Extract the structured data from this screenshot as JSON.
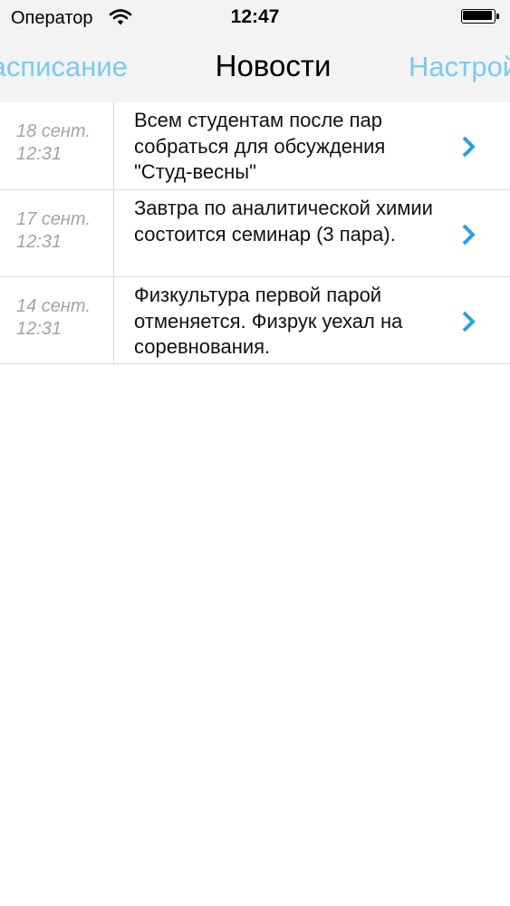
{
  "status_bar": {
    "carrier": "Оператор",
    "time": "12:47"
  },
  "nav": {
    "left_label": "Расписание",
    "title": "Новости",
    "right_label": "Настройки"
  },
  "news": [
    {
      "date": "18 сент.",
      "time": "12:31",
      "text": "Всем студентам после пар собраться для обсуждения \"Студ-весны\""
    },
    {
      "date": "17 сент.",
      "time": "12:31",
      "text": "Завтра по аналитической химии состоится семинар (3 пара)."
    },
    {
      "date": "14 сент.",
      "time": "12:31",
      "text": "Физкультура первой парой отменяется. Физрук уехал на соревнования."
    }
  ],
  "colors": {
    "accent": "#79cbef",
    "chevron": "#2aa0e6",
    "header_bg": "#f3f3f4",
    "date_text": "#a3a3a3"
  },
  "icons": {
    "wifi": "wifi-icon",
    "battery": "battery-icon",
    "chevron": "chevron-right-icon"
  }
}
